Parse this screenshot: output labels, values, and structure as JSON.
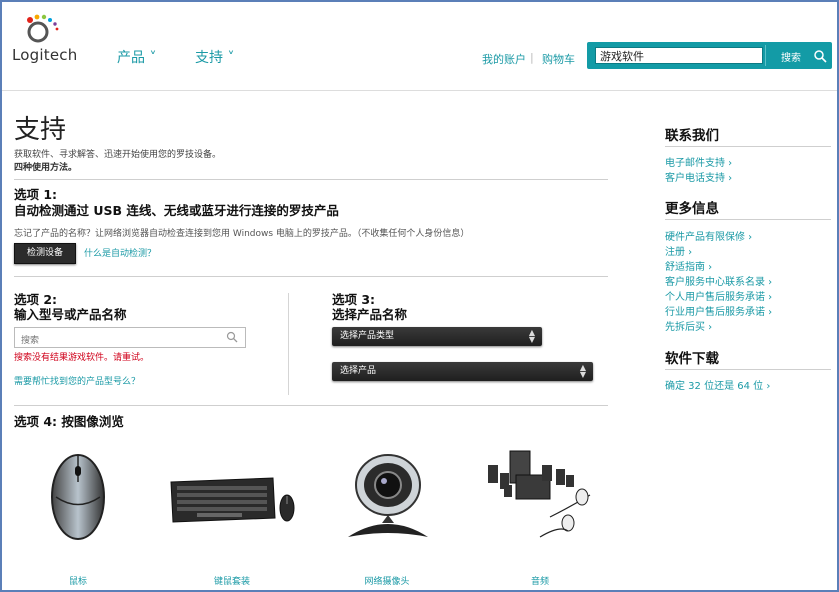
{
  "header": {
    "logo_text": "Logitech",
    "nav": [
      {
        "label": "产品 ˅"
      },
      {
        "label": "支持 ˅"
      }
    ],
    "my_account": "我的账户",
    "separator": "|",
    "cart": "购物车",
    "search": {
      "value": "游戏软件",
      "button": "搜索"
    }
  },
  "main": {
    "title": "支持",
    "intro": "获取软件、寻求解答、迅速开始使用您的罗技设备。",
    "ways": "四种使用方法。",
    "option1": {
      "label": "选项 1:",
      "title": "自动检测通过 USB 连线、无线或蓝牙进行连接的罗技产品",
      "desc": "忘记了产品的名称？让网络浏览器自动检查连接到您用 Windows 电脑上的罗技产品。（不收集任何个人身份信息）",
      "button": "检测设备",
      "link": "什么是自动检测？"
    },
    "option2": {
      "label": "选项 2:",
      "title": "输入型号或产品名称",
      "placeholder": "搜索",
      "error": "搜索没有结果游戏软件。请重试。",
      "help": "需要帮忙找到您的产品型号么？"
    },
    "option3": {
      "label": "选项 3:",
      "title": "选择产品名称",
      "select_type": "选择产品类型",
      "select_product": "选择产品"
    },
    "option4": {
      "label": "选项 4: 按图像浏览",
      "products": [
        {
          "label": "鼠标"
        },
        {
          "label": "键鼠套装"
        },
        {
          "label": "网络摄像头"
        },
        {
          "label": "音频"
        }
      ]
    }
  },
  "sidebar": {
    "contact": {
      "title": "联系我们",
      "links": [
        "电子邮件支持 ›",
        "客户电话支持 ›"
      ]
    },
    "more": {
      "title": "更多信息",
      "links": [
        "硬件产品有限保修 ›",
        "注册 ›",
        "舒适指南 ›",
        "客户服务中心联系名录 ›",
        "个人用户售后服务承诺 ›",
        "行业用户售后服务承诺 ›",
        "先拆后买 ›"
      ]
    },
    "software": {
      "title": "软件下载",
      "links": [
        "确定 32 位还是 64 位 ›"
      ]
    }
  },
  "colors": {
    "accent": "#1b9aa6",
    "error": "#d0021b",
    "button_dark": "#2b2b2b"
  }
}
